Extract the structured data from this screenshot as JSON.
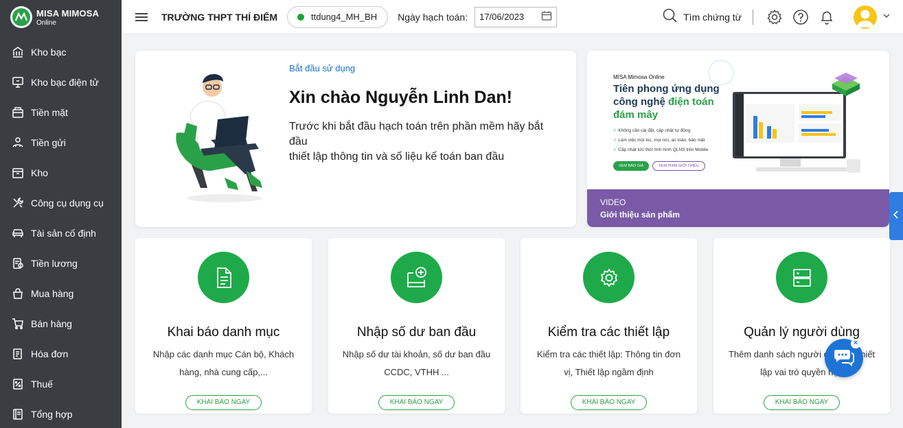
{
  "brand": {
    "name": "MISA MIMOSA",
    "sub": "Online",
    "green": "#2aa148",
    "sidebar_bg": "#3a3d42"
  },
  "sidebar": {
    "items": [
      {
        "label": "Kho bạc",
        "icon": "bank-icon"
      },
      {
        "label": "Kho bạc điện tử",
        "icon": "monitor-icon"
      },
      {
        "label": "Tiền mặt",
        "icon": "cash-icon"
      },
      {
        "label": "Tiền gửi",
        "icon": "deposit-icon"
      },
      {
        "label": "Kho",
        "icon": "warehouse-icon"
      },
      {
        "label": "Công cụ dụng cụ",
        "icon": "tools-icon"
      },
      {
        "label": "Tài sản cố định",
        "icon": "car-icon"
      },
      {
        "label": "Tiền lương",
        "icon": "salary-icon"
      },
      {
        "label": "Mua hàng",
        "icon": "bag-icon"
      },
      {
        "label": "Bán hàng",
        "icon": "cart-icon"
      },
      {
        "label": "Hóa đơn",
        "icon": "invoice-icon"
      },
      {
        "label": "Thuế",
        "icon": "tax-icon"
      },
      {
        "label": "Tổng hợp",
        "icon": "ledger-icon"
      }
    ]
  },
  "header": {
    "school": "TRƯỜNG THPT THÍ ĐIỂM",
    "database": "ttdung4_MH_BH",
    "date_label": "Ngày hạch toán:",
    "date_value": "17/06/2023",
    "search_label": "Tìm chứng từ"
  },
  "welcome": {
    "kicker": "Bắt đầu sử dụng",
    "title": "Xin chào Nguyễn Linh Dan!",
    "line1": "Trước khi bắt đầu hạch toán trên phần mềm hãy bắt đầu",
    "line2": "thiết lập thông tin và số liệu kế toán ban đầu"
  },
  "promo": {
    "brand": "MISA Mimosa Online",
    "title_a": "Tiên phong ứng dụng công nghệ ",
    "title_b": "điện toán đám mây",
    "bullets": [
      "Không cần cài đặt, cập nhật tự động",
      "Làm việc mọi lúc, mọi nơi, an toàn, bảo mật",
      "Cập nhật tức thời tình hình QLNS trên Mobile"
    ],
    "btn1": "XEM BÁO GIÁ",
    "btn2": "XEM PHIM GIỚI THIỆU",
    "band_label": "VIDEO",
    "band_title": "Giới thiệu sản phẩm"
  },
  "cards": [
    {
      "title": "Khai báo danh mục",
      "desc": "Nhập các danh mục Cán bộ, Khách hàng, nhà cung cấp,...",
      "button": "KHAI BÁO NGAY",
      "icon": "document-icon"
    },
    {
      "title": "Nhập số dư ban đầu",
      "desc": "Nhập số dư tài khoản, số dư ban đầu CCDC, VTHH ...",
      "button": "KHAI BÁO NGAY",
      "icon": "add-balance-icon"
    },
    {
      "title": "Kiểm tra các thiết lập",
      "desc": "Kiểm tra các thiết lập: Thông tin đơn vị, Thiết lập ngầm định",
      "button": "KHAI BÁO NGAY",
      "icon": "settings-icon"
    },
    {
      "title": "Quản lý người dùng",
      "desc": "Thêm danh sách người dùng và thiết lập vai trò quyền hạn",
      "button": "KHAI BÁO NGAY",
      "icon": "server-icon"
    }
  ]
}
